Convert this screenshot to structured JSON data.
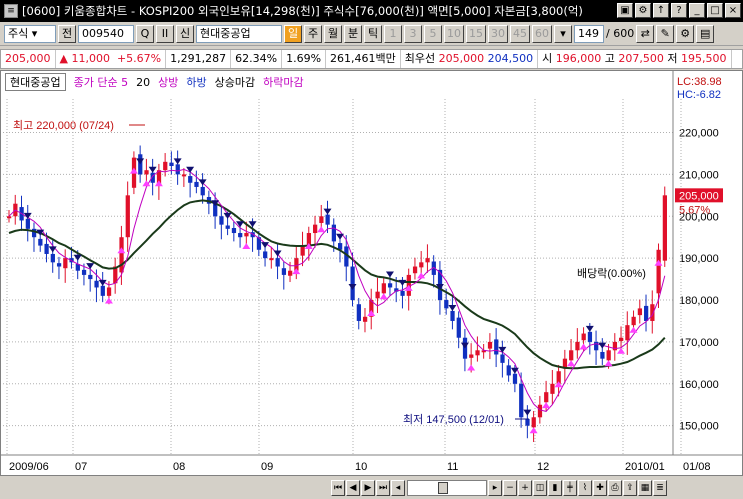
{
  "window": {
    "title": "[0600] 키움종합차트 - KOSPI200 외국인보유[14,298(천)] 주식수[76,000(천)] 액면[5,000] 자본금[3,800(억)",
    "buttons": [
      "▣",
      "⚙",
      "↑",
      "?",
      "_",
      "□",
      "×"
    ]
  },
  "toolbar": {
    "market": "주식",
    "mode": "전",
    "code": "009540",
    "code_btn": "Q",
    "pause_btn": "II",
    "name_prefix": "신",
    "name": "현대중공업",
    "periods": [
      "일",
      "주",
      "월",
      "분",
      "틱"
    ],
    "intervals": [
      "1",
      "3",
      "5",
      "10",
      "15",
      "30",
      "45",
      "60"
    ],
    "count": "149",
    "total": "/ 600"
  },
  "infobar": {
    "price": "205,000",
    "change_arrow": "▲",
    "change": "11,000",
    "change_pct": "+5.67%",
    "volume": "1,291,287",
    "ratio1": "62.34%",
    "ratio2": "1.69%",
    "amount": "261,461백만",
    "pref": "최우선",
    "ask": "205,000",
    "bid": "204,500",
    "open_label": "시",
    "open": "196,000",
    "high_label": "고",
    "high": "207,500",
    "low_label": "저",
    "low": "195,500"
  },
  "legend": {
    "name": "현대중공업",
    "ma": "종가 단순 5",
    "ma2": "20",
    "sig1": "상방",
    "sig2": "하방",
    "sig3": "상승마감",
    "sig4": "하락마감"
  },
  "chart_data": {
    "type": "line",
    "xlabel": "",
    "ylabel": "",
    "ylim": [
      143000,
      228000
    ],
    "yticks": [
      "220,000",
      "210,000",
      "200,000",
      "190,000",
      "180,000",
      "170,000",
      "160,000",
      "150,000"
    ],
    "ytick_values": [
      220000,
      210000,
      200000,
      190000,
      180000,
      170000,
      160000,
      150000
    ],
    "xticks": [
      "2009/06",
      "07",
      "08",
      "09",
      "10",
      "11",
      "12",
      "2010/01",
      "01/08"
    ],
    "lc": "LC:38.98",
    "hc": "HC:-6.82",
    "current_price_label": "205,000",
    "current_pct_label": "5.67%",
    "annotations": {
      "high": "최고 220,000 (07/24)",
      "low": "최저 147,500 (12/01)",
      "dividend": "배당락(0.00%)"
    },
    "series": [
      {
        "name": "종가",
        "values": [
          200000,
          203000,
          199000,
          197000,
          195000,
          193000,
          191000,
          189000,
          188000,
          190000,
          189000,
          187000,
          186000,
          185000,
          183000,
          181000,
          183000,
          188000,
          195000,
          205000,
          214000,
          210000,
          211000,
          208000,
          211000,
          213000,
          212000,
          210000,
          210000,
          208000,
          207000,
          205000,
          203000,
          200000,
          198000,
          197000,
          196000,
          195000,
          196000,
          195000,
          192000,
          190000,
          190000,
          188000,
          186000,
          187000,
          190000,
          193000,
          196000,
          198000,
          200000,
          198000,
          194000,
          192000,
          188000,
          180000,
          175000,
          176000,
          180000,
          182000,
          184000,
          183000,
          182000,
          181000,
          186000,
          188000,
          189000,
          190000,
          186000,
          180000,
          178000,
          175000,
          171000,
          166000,
          167000,
          168000,
          168000,
          170000,
          167000,
          165000,
          162000,
          160000,
          152000,
          150000,
          152000,
          155000,
          158000,
          160000,
          163000,
          166000,
          168000,
          170000,
          172000,
          170000,
          168000,
          166000,
          168000,
          170000,
          171000,
          174000,
          176000,
          178000,
          175000,
          179000,
          192000,
          205000
        ]
      },
      {
        "name": "20",
        "values": [
          196000,
          196500,
          196800,
          196700,
          196400,
          196000,
          195300,
          194500,
          193600,
          193000,
          192100,
          191200,
          190400,
          189500,
          188700,
          187800,
          187500,
          187600,
          188400,
          189600,
          191200,
          192700,
          194200,
          195800,
          197200,
          198800,
          200200,
          201500,
          202600,
          203300,
          203600,
          203800,
          203600,
          203100,
          202400,
          201500,
          200500,
          199300,
          198100,
          197000,
          195900,
          194900,
          194000,
          193500,
          193200,
          193000,
          192900,
          192900,
          193000,
          193200,
          193400,
          193200,
          192600,
          191900,
          190900,
          189700,
          188400,
          187100,
          186100,
          185600,
          185400,
          185100,
          184600,
          184300,
          184300,
          184300,
          184200,
          184000,
          183500,
          182700,
          181900,
          181000,
          179800,
          178500,
          177300,
          176300,
          175500,
          175000,
          174500,
          173900,
          173000,
          171900,
          170300,
          168700,
          167300,
          166200,
          165300,
          164500,
          164100,
          163800,
          163700,
          163700,
          163900,
          164000,
          164000,
          164100,
          164300,
          164500,
          164800,
          165200,
          165900,
          166700,
          167400,
          168200,
          169400,
          171000
        ]
      }
    ]
  }
}
